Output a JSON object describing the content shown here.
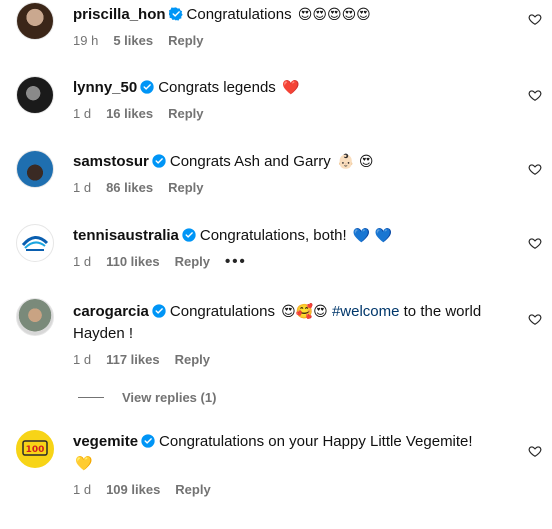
{
  "colors": {
    "meta_text": "#737373",
    "hashtag": "#00376b",
    "verified": "#0095f6"
  },
  "comments": [
    {
      "username": "priscilla_hon",
      "text": "Congratulations",
      "emojis": "😍😍😍😍😍",
      "time": "19 h",
      "likes": "5 likes",
      "reply": "Reply"
    },
    {
      "username": "lynny_50",
      "text": "Congrats legends",
      "emojis": "❤️",
      "time": "1 d",
      "likes": "16 likes",
      "reply": "Reply"
    },
    {
      "username": "samstosur",
      "text": "Congrats Ash and Garry",
      "emojis": "👶🏻 😍",
      "time": "1 d",
      "likes": "86 likes",
      "reply": "Reply"
    },
    {
      "username": "tennisaustralia",
      "text": "Congratulations, both!",
      "emojis": "💙 💙",
      "time": "1 d",
      "likes": "110 likes",
      "reply": "Reply",
      "more": "•••"
    },
    {
      "username": "carogarcia",
      "text": "Congratulations",
      "emojis": "😍🥰😍",
      "hashtag": "#welcome",
      "text_after": "to the world",
      "text_line2": "Hayden !",
      "time": "1 d",
      "likes": "117 likes",
      "reply": "Reply",
      "view_replies": "View replies (1)"
    },
    {
      "username": "vegemite",
      "text": "Congratulations on your Happy Little Vegemite!",
      "emojis": "💛",
      "time": "1 d",
      "likes": "109 likes",
      "reply": "Reply"
    }
  ]
}
